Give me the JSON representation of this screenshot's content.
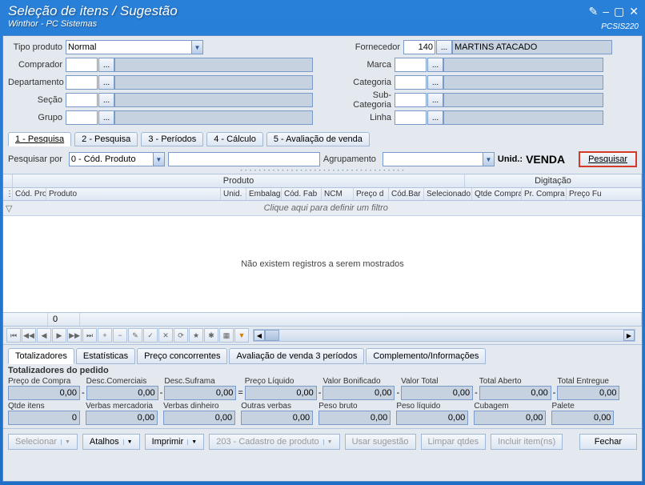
{
  "title": "Seleção de itens / Sugestão",
  "subtitle": "Winthor - PC Sistemas",
  "app_code": "PCSIS220",
  "form": {
    "tipo_produto": {
      "label": "Tipo produto",
      "value": "Normal"
    },
    "comprador": {
      "label": "Comprador"
    },
    "departamento": {
      "label": "Departamento"
    },
    "secao": {
      "label": "Seção"
    },
    "grupo": {
      "label": "Grupo"
    },
    "fornecedor": {
      "label": "Fornecedor",
      "value": "140",
      "name": "MARTINS ATACADO"
    },
    "marca": {
      "label": "Marca"
    },
    "categoria": {
      "label": "Categoria"
    },
    "subcategoria": {
      "label": "Sub-Categoria"
    },
    "linha": {
      "label": "Linha"
    }
  },
  "tabs1": [
    "1 - Pesquisa",
    "2 - Pesquisa",
    "3 - Períodos",
    "4 - Cálculo",
    "5 - Avaliação de venda"
  ],
  "search": {
    "label": "Pesquisar por",
    "value": "0 - Cód. Produto",
    "agrupamento_label": "Agrupamento",
    "unid_label": "Unid.:",
    "unid_value": "VENDA",
    "button": "Pesquisar"
  },
  "grid": {
    "group_produto": "Produto",
    "group_digitacao": "Digitação",
    "cols": [
      "Cód. Pro",
      "Produto",
      "Unid.",
      "Embalag",
      "Cód. Fab",
      "NCM",
      "Preço d",
      "Cód.Bar",
      "Selecionado",
      "Qtde Compra",
      "Pr. Compra",
      "Preço Fu"
    ],
    "filter_hint": "Clique aqui para definir um filtro",
    "empty": "Não existem registros a serem mostrados",
    "index": "0"
  },
  "tabs2": [
    "Totalizadores",
    "Estatísticas",
    "Preço concorrentes",
    "Avaliação de venda 3 períodos",
    "Complemento/Informações"
  ],
  "totalizers": {
    "title": "Totalizadores do pedido",
    "row1": [
      {
        "label": "Preço de Compra",
        "value": "0,00"
      },
      {
        "label": "Desc.Comerciais",
        "value": "0,00"
      },
      {
        "label": "Desc.Suframa",
        "value": "0,00"
      },
      {
        "label": "Preço Líquido",
        "value": "0,00"
      },
      {
        "label": "Valor Bonificado",
        "value": "0,00"
      },
      {
        "label": "Valor Total",
        "value": "0,00"
      },
      {
        "label": "Total Aberto",
        "value": "0,00"
      },
      {
        "label": "Total Entregue",
        "value": "0,00"
      }
    ],
    "row2": [
      {
        "label": "Qtde itens",
        "value": "0"
      },
      {
        "label": "Verbas mercadoria",
        "value": "0,00"
      },
      {
        "label": "Verbas dinheiro",
        "value": "0,00"
      },
      {
        "label": "Outras verbas",
        "value": "0,00"
      },
      {
        "label": "Peso bruto",
        "value": "0,00"
      },
      {
        "label": "Peso líquido",
        "value": "0,00"
      },
      {
        "label": "Cubagem",
        "value": "0,00"
      },
      {
        "label": "Palete",
        "value": "0,00"
      }
    ]
  },
  "footer": {
    "selecionar": "Selecionar",
    "atalhos": "Atalhos",
    "imprimir": "Imprimir",
    "cadastro": "203 - Cadastro de produto",
    "usar_sugestao": "Usar sugestão",
    "limpar": "Limpar qtdes",
    "incluir": "Incluir item(ns)",
    "fechar": "Fechar"
  }
}
